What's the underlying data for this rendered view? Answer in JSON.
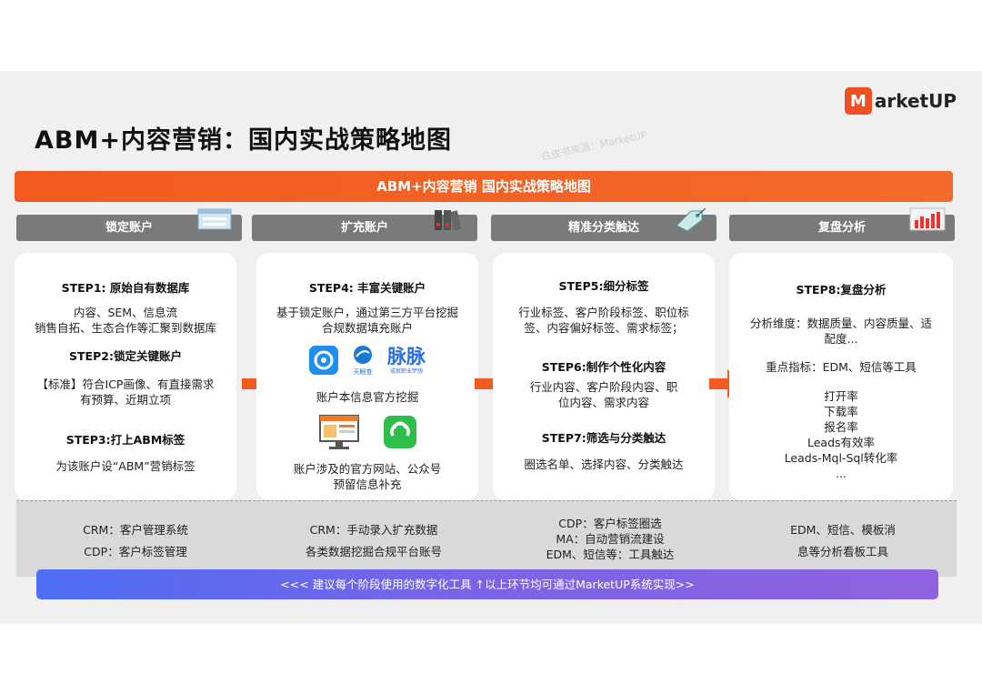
{
  "title": "ABM+内容营销：国内实战策略地图",
  "logo": {
    "badge": "M",
    "text": "arketUP"
  },
  "watermark": "白皮书来源：MarketUP",
  "banner": "ABM+内容营销 国内实战策略地图",
  "phases": [
    "锁定账户",
    "扩充账户",
    "精准分类触达",
    "复盘分析"
  ],
  "cards": {
    "c1": {
      "step1": "STEP1: 原始自有数据库",
      "step1_l1": "内容、SEM、信息流",
      "step1_l2": "销售自拓、生态合作等汇聚到数据库",
      "step2": "STEP2:锁定关键账户",
      "step2_l1": "【标准】符合ICP画像、有直接需求",
      "step2_l2": "有预算、近期立项",
      "step3": "STEP3:打上ABM标签",
      "step3_l1": "为该账户设“ABM”营销标签"
    },
    "c2": {
      "step4": "STEP4: 丰富关键账户",
      "l1": "基于锁定账户，通过第三方平台挖掘",
      "l2": "合规数据填充账户",
      "app2_label": "天眼查",
      "app3_label": "脉脉",
      "app3_sub": "成就职业梦想",
      "l3": "账户本信息官方挖掘",
      "l4": "账户涉及的官方网站、公众号",
      "l5": "预留信息补充"
    },
    "c3": {
      "step5": "STEP5:细分标签",
      "s5_l1": "行业标签、客户阶段标签、职位标",
      "s5_l2": "签、内容偏好标签、需求标签；",
      "step6": "STEP6:制作个性化内容",
      "s6_l1": "行业内容、客户阶段内容、职",
      "s6_l2": "位内容、需求内容",
      "step7": "STEP7:筛选与分类触达",
      "s7_l1": "圈选名单、选择内容、分类触达"
    },
    "c4": {
      "step8": "STEP8:复盘分析",
      "l1": "分析维度：数据质量、内容质量、适",
      "l2": "配度...",
      "l3": "重点指标：EDM、短信等工具",
      "m1": "打开率",
      "m2": "下载率",
      "m3": "报名率",
      "m4": "Leads有效率",
      "m5": "Leads-Mql-Sql转化率",
      "m6": "..."
    }
  },
  "tools": {
    "t1": [
      "CRM：客户管理系统",
      "CDP：客户标签管理"
    ],
    "t2": [
      "CRM：手动录入扩充数据",
      "各类数据挖掘合规平台账号"
    ],
    "t3": [
      "CDP：客户标签圈选",
      "MA：自动营销流建设",
      "EDM、短信等：工具触达"
    ],
    "t4": [
      "EDM、短信、模板消",
      "息等分析看板工具"
    ]
  },
  "bottom_bar": "<<< 建议每个阶段使用的数字化工具 ↑以上环节均可通过MarketUP系统实现>>",
  "colors": {
    "accent": "#f25a1f",
    "phase_bg": "#7a7a7a",
    "bar_start": "#4d6ef5",
    "bar_end": "#8f63e0"
  }
}
